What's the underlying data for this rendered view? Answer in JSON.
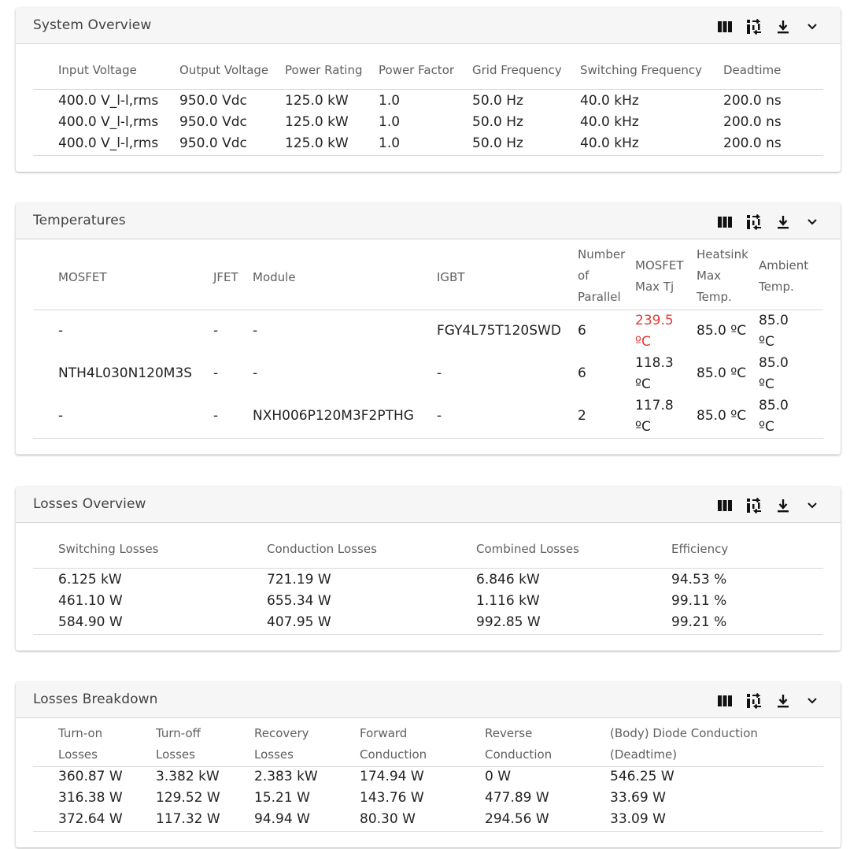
{
  "system_overview": {
    "title": "System Overview",
    "columns": [
      "Input Voltage",
      "Output Voltage",
      "Power Rating",
      "Power Factor",
      "Grid Frequency",
      "Switching Frequency",
      "Deadtime"
    ],
    "rows": [
      [
        "400.0 V_l-l,rms",
        "950.0 Vdc",
        "125.0 kW",
        "1.0",
        "50.0 Hz",
        "40.0 kHz",
        "200.0 ns"
      ],
      [
        "400.0 V_l-l,rms",
        "950.0 Vdc",
        "125.0 kW",
        "1.0",
        "50.0 Hz",
        "40.0 kHz",
        "200.0 ns"
      ],
      [
        "400.0 V_l-l,rms",
        "950.0 Vdc",
        "125.0 kW",
        "1.0",
        "50.0 Hz",
        "40.0 kHz",
        "200.0 ns"
      ]
    ]
  },
  "temperatures": {
    "title": "Temperatures",
    "columns": [
      "MOSFET",
      "JFET",
      "Module",
      "IGBT",
      "Number of Parallel",
      "MOSFET Max Tj",
      "Heatsink Max Temp.",
      "Ambient Temp."
    ],
    "rows": [
      [
        "-",
        "-",
        "-",
        "FGY4L75T120SWD",
        "6",
        "239.5 ºC",
        "85.0 ºC",
        "85.0 ºC"
      ],
      [
        "NTH4L030N120M3S",
        "-",
        "-",
        "-",
        "6",
        "118.3 ºC",
        "85.0 ºC",
        "85.0 ºC"
      ],
      [
        "-",
        "-",
        "NXH006P120M3F2PTHG",
        "-",
        "2",
        "117.8 ºC",
        "85.0 ºC",
        "85.0 ºC"
      ]
    ],
    "highlight_color": "#e53935"
  },
  "losses_overview": {
    "title": "Losses Overview",
    "columns": [
      "Switching Losses",
      "Conduction Losses",
      "Combined Losses",
      "Efficiency"
    ],
    "rows": [
      [
        "6.125 kW",
        "721.19 W",
        "6.846 kW",
        "94.53 %"
      ],
      [
        "461.10 W",
        "655.34 W",
        "1.116 kW",
        "99.11 %"
      ],
      [
        "584.90 W",
        "407.95 W",
        "992.85 W",
        "99.21 %"
      ]
    ]
  },
  "losses_breakdown": {
    "title": "Losses Breakdown",
    "columns": [
      "Turn-on Losses",
      "Turn-off Losses",
      "Recovery Losses",
      "Forward Conduction",
      "Reverse Conduction",
      "(Body) Diode Conduction (Deadtime)"
    ],
    "rows": [
      [
        "360.87 W",
        "3.382 kW",
        "2.383 kW",
        "174.94 W",
        "0 W",
        "546.25 W"
      ],
      [
        "316.38 W",
        "129.52 W",
        "15.21 W",
        "143.76 W",
        "477.89 W",
        "33.69 W"
      ],
      [
        "372.64 W",
        "117.32 W",
        "94.94 W",
        "80.30 W",
        "294.56 W",
        "33.09 W"
      ]
    ]
  },
  "toolbar_icons": [
    "columns-icon",
    "swap-icon",
    "download-icon",
    "chevron-down-icon"
  ]
}
